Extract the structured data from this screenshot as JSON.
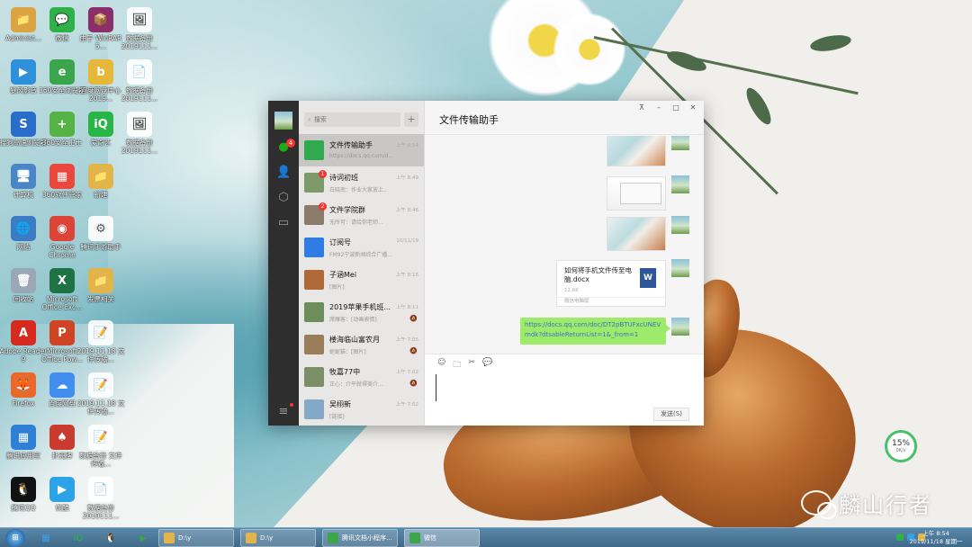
{
  "desktop": {
    "icons": [
      {
        "label": "Administ...",
        "glyph": "📁",
        "color": "#d9a441",
        "col": 0,
        "row": 0
      },
      {
        "label": "微信",
        "glyph": "💬",
        "color": "#2fb14a",
        "col": 1,
        "row": 0
      },
      {
        "label": "由于 WinRAR 5...",
        "glyph": "📦",
        "color": "#8b2f6a",
        "col": 2,
        "row": 0
      },
      {
        "label": "数据备份 2019111...",
        "glyph": "🖼",
        "color": "#ffffff",
        "col": 3,
        "row": 0
      },
      {
        "label": "暴风影音",
        "glyph": "▶",
        "color": "#2e8fdb",
        "col": 0,
        "row": 1
      },
      {
        "label": "360安全浏览器",
        "glyph": "e",
        "color": "#3aa54b",
        "col": 1,
        "row": 1
      },
      {
        "label": "百度网盘中心 2019...",
        "glyph": "b",
        "color": "#e6b83a",
        "col": 2,
        "row": 1
      },
      {
        "label": "数据备份 2019111...",
        "glyph": "📄",
        "color": "#ffffff",
        "col": 3,
        "row": 1
      },
      {
        "label": "搜狗高速浏览器",
        "glyph": "S",
        "color": "#2a6cc9",
        "col": 0,
        "row": 2
      },
      {
        "label": "360安全卫士",
        "glyph": "+",
        "color": "#55b346",
        "col": 1,
        "row": 2
      },
      {
        "label": "爱奇艺",
        "glyph": "iQ",
        "color": "#28b446",
        "col": 2,
        "row": 2
      },
      {
        "label": "数据备份 2019111...",
        "glyph": "🖼",
        "color": "#ffffff",
        "col": 3,
        "row": 2
      },
      {
        "label": "计算机",
        "glyph": "🖥",
        "color": "#4a86c5",
        "col": 0,
        "row": 3
      },
      {
        "label": "360软件管家",
        "glyph": "▦",
        "color": "#e9483b",
        "col": 1,
        "row": 3
      },
      {
        "label": "新建",
        "glyph": "📁",
        "color": "#e1b44c",
        "col": 2,
        "row": 3
      },
      {
        "label": "网络",
        "glyph": "🌐",
        "color": "#3b7dc4",
        "col": 0,
        "row": 4
      },
      {
        "label": "Google Chrome",
        "glyph": "◉",
        "color": "#db4437",
        "col": 1,
        "row": 4
      },
      {
        "label": "腾讯手游助手",
        "glyph": "⚙",
        "color": "#ffffff",
        "col": 2,
        "row": 4
      },
      {
        "label": "回收站",
        "glyph": "🗑",
        "color": "#9aa7b5",
        "col": 0,
        "row": 5
      },
      {
        "label": "Microsoft Office Exc...",
        "glyph": "X",
        "color": "#1f7244",
        "col": 1,
        "row": 5
      },
      {
        "label": "发票相关",
        "glyph": "📁",
        "color": "#e1b44c",
        "col": 2,
        "row": 5
      },
      {
        "label": "Adobe Reader 9",
        "glyph": "A",
        "color": "#d62a1e",
        "col": 0,
        "row": 6
      },
      {
        "label": "Microsoft Office Pow...",
        "glyph": "P",
        "color": "#d04423",
        "col": 1,
        "row": 6
      },
      {
        "label": "2019.11.18 文件传输...",
        "glyph": "📝",
        "color": "#ffffff",
        "col": 2,
        "row": 6
      },
      {
        "label": "Firefox",
        "glyph": "🦊",
        "color": "#e8692c",
        "col": 0,
        "row": 7
      },
      {
        "label": "百度网盘",
        "glyph": "☁",
        "color": "#3f8ef0",
        "col": 1,
        "row": 7
      },
      {
        "label": "2019.11.18 文件传输...",
        "glyph": "📝",
        "color": "#ffffff",
        "col": 2,
        "row": 7
      },
      {
        "label": "腾讯应用宝",
        "glyph": "▦",
        "color": "#2e7fd6",
        "col": 0,
        "row": 8
      },
      {
        "label": "扑克牌",
        "glyph": "♠",
        "color": "#c93b2e",
        "col": 1,
        "row": 8
      },
      {
        "label": "数据备份 文件传输...",
        "glyph": "📝",
        "color": "#ffffff",
        "col": 2,
        "row": 8
      },
      {
        "label": "腾讯QQ",
        "glyph": "🐧",
        "color": "#111111",
        "col": 0,
        "row": 9
      },
      {
        "label": "优酷",
        "glyph": "▶",
        "color": "#2aa3e8",
        "col": 1,
        "row": 9
      },
      {
        "label": "数据备份 2019111...",
        "glyph": "📄",
        "color": "#ffffff",
        "col": 2,
        "row": 9
      }
    ]
  },
  "watermark": {
    "text": "麟山行者"
  },
  "gauge": {
    "percent": "15%",
    "speed": "0K/s"
  },
  "wechat": {
    "nav": {
      "chat_badge": "4"
    },
    "search": {
      "placeholder": "搜索",
      "add_label": "+"
    },
    "chats": [
      {
        "name": "文件传输助手",
        "time": "上午 8:54",
        "preview": "https://docs.qq.com/d...",
        "avatar_color": "#31a94f",
        "badge": "",
        "muted": false,
        "active": true
      },
      {
        "name": "诗词初班",
        "time": "上午 8:49",
        "preview": "白晓南：作业大家放上..",
        "avatar_color": "#7c9a6a",
        "badge": "1",
        "muted": false,
        "active": false
      },
      {
        "name": "文件学院群",
        "time": "上午 8:46",
        "preview": "无所可：请给你老师...",
        "avatar_color": "#8a7b6a",
        "badge": "2",
        "muted": false,
        "active": false
      },
      {
        "name": "订阅号",
        "time": "10/11/19",
        "preview": "FM92宁波新闻综合广播...",
        "avatar_color": "#2f7ce3",
        "badge": "",
        "muted": false,
        "active": false
      },
      {
        "name": "子涵Mei",
        "time": "上午 8:16",
        "preview": "[图片]",
        "avatar_color": "#b06a3a",
        "badge": "",
        "muted": false,
        "active": false
      },
      {
        "name": "2019苹果手机班...",
        "time": "上午 8:11",
        "preview": "席雁客：[动画表情]",
        "avatar_color": "#6b8e5a",
        "badge": "",
        "muted": true,
        "active": false
      },
      {
        "name": "楼海临山富农月",
        "time": "上午 7:05",
        "preview": "妮妮猫：[图片]",
        "avatar_color": "#9a7e5a",
        "badge": "",
        "muted": true,
        "active": false
      },
      {
        "name": "牧嘉77中",
        "time": "上午 7:02",
        "preview": "正心：介平就得美介...",
        "avatar_color": "#7a8f66",
        "badge": "",
        "muted": true,
        "active": false
      },
      {
        "name": "吴栩新",
        "time": "上午 7:02",
        "preview": "[链接]",
        "avatar_color": "#84a9c6",
        "badge": "",
        "muted": false,
        "active": false
      }
    ],
    "main": {
      "title": "文件传输助手",
      "window_buttons": {
        "pin": "⊼",
        "minimize": "–",
        "maximize": "□",
        "close": "✕"
      },
      "file_message": {
        "name": "如何将手机文件传至电脑.docx",
        "size": "12.6K",
        "source": "微信电脑版",
        "icon": "W"
      },
      "link_message": "https://docs.qq.com/doc/DT2pBTUFxcUNEVmdk?dtsableReturnList=1&_from=1",
      "toolbar": {
        "emoji": "☺",
        "folder": "🗀",
        "scissors": "✂",
        "chat": "💬"
      },
      "send_label": "发送(S)"
    }
  },
  "taskbar": {
    "start": "⊞",
    "pinned": [
      {
        "glyph": "▦",
        "color": "#3a9fe0"
      },
      {
        "glyph": "iQ",
        "color": "#28b446"
      },
      {
        "glyph": "🐧",
        "color": "#222"
      },
      {
        "glyph": "▶",
        "color": "#3aa54b"
      }
    ],
    "tasks": [
      {
        "label": "D:\\y",
        "color": "#e1b44c",
        "active": false
      },
      {
        "label": "D:\\y",
        "color": "#e1b44c",
        "active": false
      },
      {
        "label": "腾讯文档小程序...",
        "color": "#3aa54b",
        "active": false
      },
      {
        "label": "微信",
        "color": "#3aa54b",
        "active": true
      }
    ],
    "clock": {
      "time": "上午 8:54",
      "date": "2019/11/18 星期一"
    }
  }
}
